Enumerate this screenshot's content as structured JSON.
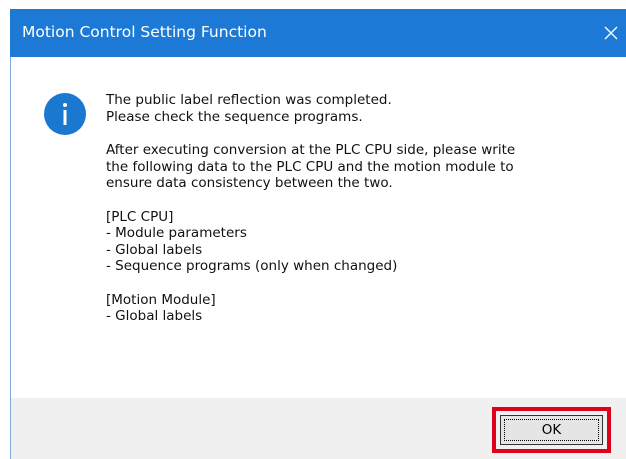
{
  "window": {
    "title": "Motion Control Setting Function",
    "close_icon": "close-icon"
  },
  "message": {
    "icon": "info-icon",
    "paragraphs": [
      [
        "The public label reflection was completed.",
        "Please check the sequence programs."
      ],
      [
        "After executing conversion at the PLC CPU side, please write",
        "the following data to the PLC CPU and the motion module to",
        "ensure data consistency between the two."
      ],
      [
        "[PLC CPU]",
        "- Module parameters",
        "- Global labels",
        "- Sequence programs (only when changed)"
      ],
      [
        "[Motion Module]",
        "- Global labels"
      ]
    ]
  },
  "footer": {
    "ok_label": "OK"
  },
  "colors": {
    "titlebar": "#1c7ad6",
    "footer": "#f0f0f0",
    "highlight": "#e0001b",
    "info_icon": "#1a78d0"
  }
}
